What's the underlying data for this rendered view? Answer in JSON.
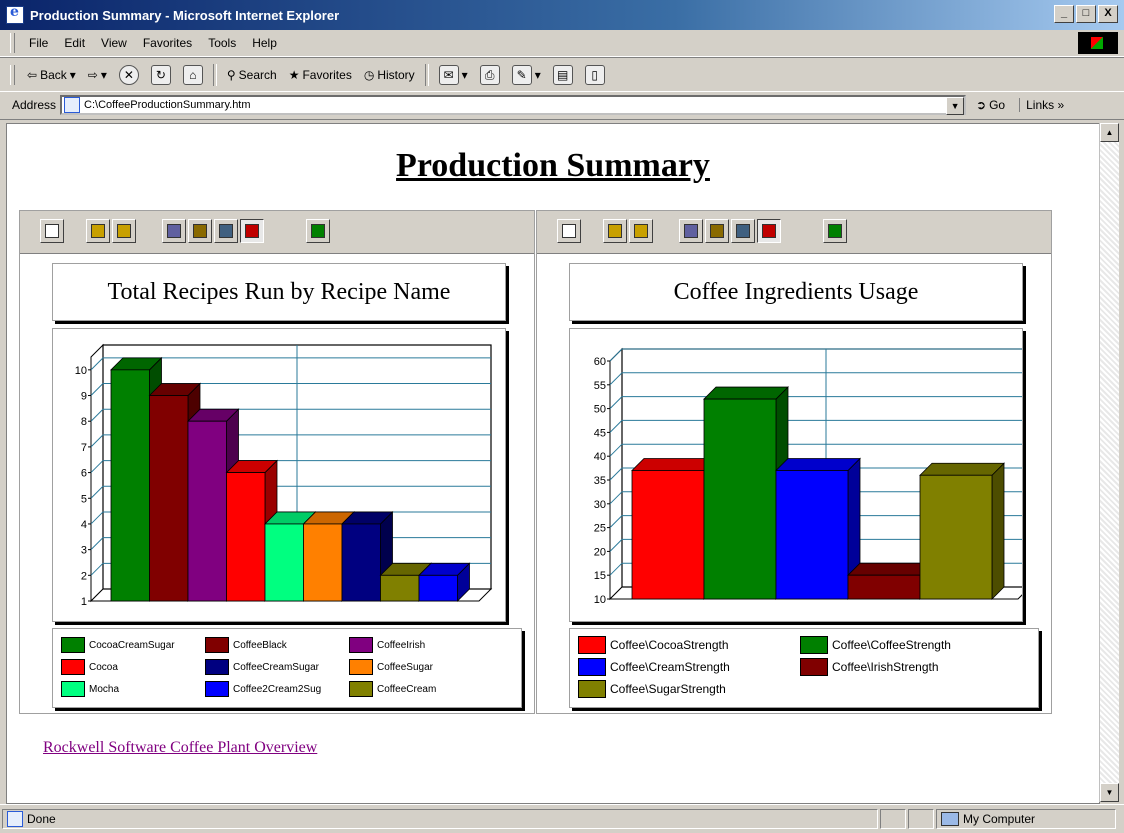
{
  "window": {
    "title": "Production Summary - Microsoft Internet Explorer",
    "btn_min": "_",
    "btn_max": "□",
    "btn_close": "X"
  },
  "menu": [
    "File",
    "Edit",
    "View",
    "Favorites",
    "Tools",
    "Help"
  ],
  "toolbar": {
    "back": "Back",
    "search": "Search",
    "favorites": "Favorites",
    "history": "History"
  },
  "address": {
    "label": "Address",
    "value": "C:\\CoffeeProductionSummary.htm",
    "go": "Go",
    "links": "Links"
  },
  "page": {
    "title": "Production Summary",
    "link": "Rockwell Software Coffee Plant Overview"
  },
  "status": {
    "left": "Done",
    "zone": "My Computer"
  },
  "icons": {
    "panel_buttons": [
      "properties-icon",
      "copy-icon",
      "paste-icon",
      "data-grid-icon",
      "bar-view-icon",
      "area-view-icon",
      "chart-view-icon",
      "refresh-icon"
    ]
  },
  "chart_data": [
    {
      "type": "bar",
      "title": "Total Recipes Run by Recipe Name",
      "categories": [
        "CocoaCreamSugar",
        "CoffeeBlack",
        "CoffeeIrish",
        "Cocoa",
        "Mocha",
        "CoffeeSugar",
        "CoffeeCreamSugar",
        "CoffeeCream",
        "Coffee2Cream2Sug"
      ],
      "values": [
        10,
        9,
        8,
        6,
        4,
        4,
        4,
        2,
        2
      ],
      "colors": [
        "#008000",
        "#800000",
        "#800080",
        "#ff0000",
        "#00ff80",
        "#ff8000",
        "#000080",
        "#808000",
        "#0000ff"
      ],
      "legend": [
        {
          "label": "CocoaCreamSugar",
          "color": "#008000"
        },
        {
          "label": "CoffeeBlack",
          "color": "#800000"
        },
        {
          "label": "CoffeeIrish",
          "color": "#800080"
        },
        {
          "label": "Cocoa",
          "color": "#ff0000"
        },
        {
          "label": "CoffeeCreamSugar",
          "color": "#000080"
        },
        {
          "label": "CoffeeSugar",
          "color": "#ff8000"
        },
        {
          "label": "Mocha",
          "color": "#00ff80"
        },
        {
          "label": "Coffee2Cream2Sug",
          "color": "#0000ff"
        },
        {
          "label": "CoffeeCream",
          "color": "#808000"
        }
      ],
      "yticks": [
        "1",
        "2",
        "3",
        "4",
        "5",
        "6",
        "7",
        "8",
        "9",
        "10"
      ],
      "ylim": [
        1,
        10.5
      ],
      "grid": true,
      "legend_position": "bottom"
    },
    {
      "type": "bar",
      "title": "Coffee Ingredients  Usage",
      "categories": [
        "Coffee\\CocoaStrength",
        "Coffee\\CoffeeStrength",
        "Coffee\\CreamStrength",
        "Coffee\\IrishStrength",
        "Coffee\\SugarStrength"
      ],
      "values": [
        37,
        52,
        37,
        15,
        36
      ],
      "colors": [
        "#ff0000",
        "#008000",
        "#0000ff",
        "#800000",
        "#808000"
      ],
      "legend": [
        {
          "label": "Coffee\\CocoaStrength",
          "color": "#ff0000"
        },
        {
          "label": "Coffee\\CoffeeStrength",
          "color": "#008000"
        },
        {
          "label": "Coffee\\CreamStrength",
          "color": "#0000ff"
        },
        {
          "label": "Coffee\\IrishStrength",
          "color": "#800000"
        },
        {
          "label": "Coffee\\SugarStrength",
          "color": "#808000"
        }
      ],
      "yticks": [
        "10",
        "15",
        "20",
        "25",
        "30",
        "35",
        "40",
        "45",
        "50",
        "55",
        "60"
      ],
      "ylim": [
        10,
        60
      ],
      "grid": true,
      "legend_position": "bottom"
    }
  ]
}
